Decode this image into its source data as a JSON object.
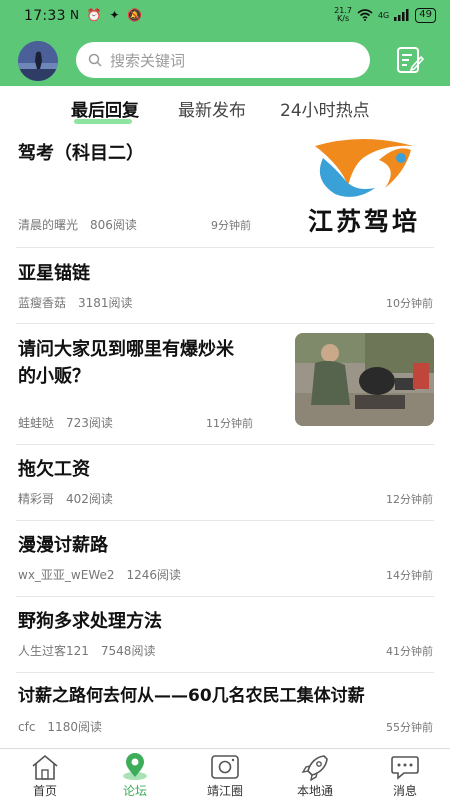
{
  "status_bar": {
    "time": "17:33",
    "left_icons": "N ⏰ ✦ 🔕",
    "speed_top": "21.7",
    "speed_bottom": "K/s",
    "network": "4G",
    "battery": "49"
  },
  "search": {
    "placeholder": "搜索关键词"
  },
  "tabs": [
    {
      "label": "最后回复",
      "active": true
    },
    {
      "label": "最新发布",
      "active": false
    },
    {
      "label": "24小时热点",
      "active": false
    }
  ],
  "posts": [
    {
      "title": "驾考（科目二）",
      "author": "清晨的曙光",
      "reads": "806阅读",
      "time": "9分钟前",
      "thumb_caption": "江苏驾培"
    },
    {
      "title": "亚星锚链",
      "author": "蓝瘦香菇",
      "reads": "3181阅读",
      "time": "10分钟前"
    },
    {
      "title_lines": [
        "请问大家见到哪里有爆炒米",
        "的小贩？"
      ],
      "author": "蛙蛙哒",
      "reads": "723阅读",
      "time": "11分钟前"
    },
    {
      "title": "拖欠工资",
      "author": "精彩哥",
      "reads": "402阅读",
      "time": "12分钟前"
    },
    {
      "title": "漫漫讨薪路",
      "author": "wx_亚亚_wEWe2",
      "reads": "1246阅读",
      "time": "14分钟前"
    },
    {
      "title": "野狗多求处理方法",
      "author": "人生过客121",
      "reads": "7548阅读",
      "time": "41分钟前"
    },
    {
      "title": "讨薪之路何去何从——60几名农民工集体讨薪",
      "author": "cfc",
      "reads": "1180阅读",
      "time": "55分钟前"
    }
  ],
  "bottom_nav": [
    {
      "label": "首页",
      "icon": "home-icon",
      "active": false
    },
    {
      "label": "论坛",
      "icon": "forum-location-icon",
      "active": true
    },
    {
      "label": "靖江圈",
      "icon": "camera-circle-icon",
      "active": false
    },
    {
      "label": "本地通",
      "icon": "rocket-icon",
      "active": false
    },
    {
      "label": "消息",
      "icon": "message-icon",
      "active": false
    }
  ],
  "colors": {
    "header_green": "#5cc877",
    "tab_underline": "#8ee3a1",
    "nav_active": "#3dad5a",
    "logo_orange": "#f08a1c",
    "logo_blue": "#3aa0d8"
  }
}
